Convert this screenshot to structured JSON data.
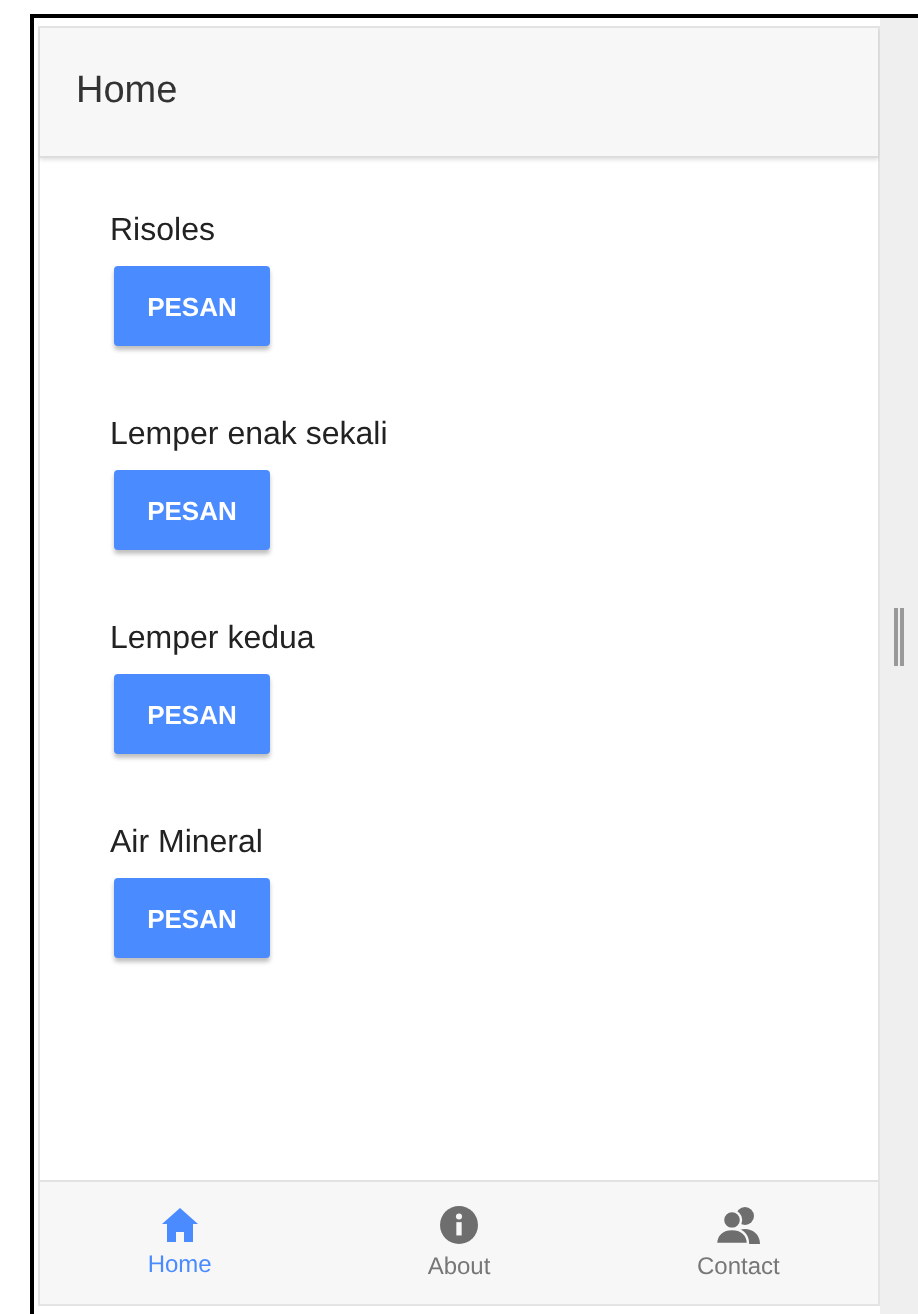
{
  "header": {
    "title": "Home"
  },
  "products": [
    {
      "name": "Risoles",
      "button": "PESAN"
    },
    {
      "name": "Lemper enak sekali",
      "button": "PESAN"
    },
    {
      "name": "Lemper kedua",
      "button": "PESAN"
    },
    {
      "name": "Air Mineral",
      "button": "PESAN"
    }
  ],
  "tab_bar": [
    {
      "kind": "home",
      "label": "Home",
      "selected": true
    },
    {
      "kind": "about",
      "label": "About",
      "selected": false
    },
    {
      "kind": "contact",
      "label": "Contact",
      "selected": false
    }
  ]
}
